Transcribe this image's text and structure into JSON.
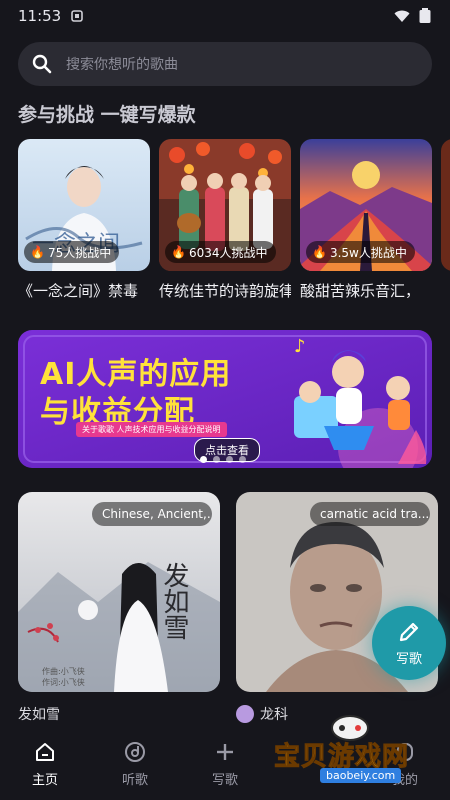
{
  "status": {
    "time": "11:53"
  },
  "search": {
    "placeholder": "搜索你想听的歌曲"
  },
  "challenges": {
    "title": "参与挑战 一键写爆款",
    "items": [
      {
        "badge": "75人挑战中",
        "title": "《一念之间》禁毒"
      },
      {
        "badge": "6034人挑战中",
        "title": "传统佳节的诗韵旋律"
      },
      {
        "badge": "3.5w人挑战中",
        "title": "酸甜苦辣乐音汇，"
      }
    ]
  },
  "banner": {
    "title_line1": "AI人声的应用",
    "title_line2": "与收益分配",
    "subtitle": "关于歌歌 人声技术应用与收益分配说明",
    "cta": "点击查看",
    "active_dot": 0
  },
  "feed": {
    "items": [
      {
        "tag": "Chinese, Ancient,...",
        "caption": "发如雪",
        "art_text": "发如雪"
      },
      {
        "tag": "carnatic acid tra...",
        "caption": "龙科"
      }
    ]
  },
  "fab": {
    "label": "写歌",
    "icon": "pencil-icon"
  },
  "tabs": [
    {
      "label": "主页",
      "icon": "home-icon",
      "active": true
    },
    {
      "label": "听歌",
      "icon": "music-disc-icon"
    },
    {
      "label": "写歌",
      "icon": "plus-icon"
    },
    {
      "label": "",
      "icon": ""
    },
    {
      "label": "我的",
      "icon": "profile-icon"
    }
  ],
  "watermark": {
    "title": "宝贝游戏网",
    "url": "baobeiy.com"
  },
  "colors": {
    "accent": "#1f9aa8",
    "background": "#16161c",
    "banner": "#7b2fd8",
    "banner_title": "#ffe23a"
  }
}
